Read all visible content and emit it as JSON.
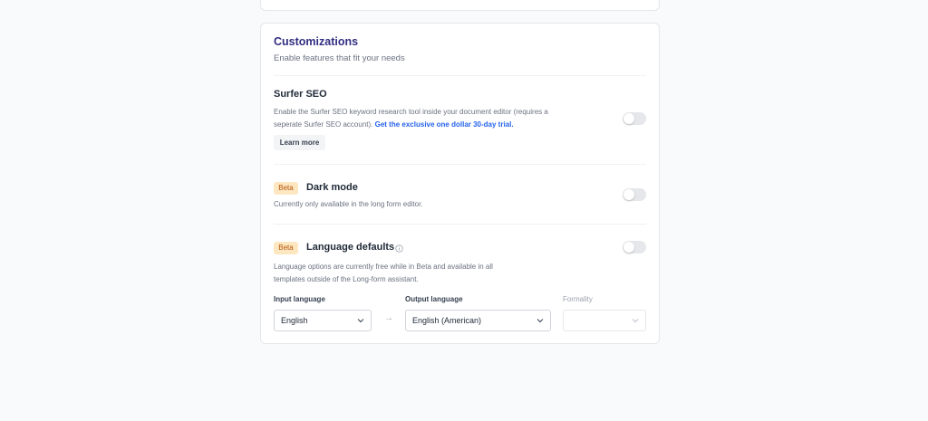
{
  "customizations": {
    "title": "Customizations",
    "subtitle": "Enable features that fit your needs"
  },
  "surfer": {
    "title": "Surfer SEO",
    "description_line1": "Enable the Surfer SEO keyword research tool inside your document editor (requires a",
    "description_line2": "seperate Surfer SEO account).",
    "trial_link": "Get the exclusive one dollar 30-day trial.",
    "learn_more": "Learn more",
    "enabled": false
  },
  "dark_mode": {
    "badge": "Beta",
    "title": "Dark mode",
    "description": "Currently only available in the long form editor.",
    "enabled": false
  },
  "language": {
    "badge": "Beta",
    "title": "Language defaults",
    "description_line1": "Language options are currently free while in Beta and available in all",
    "description_line2": "templates outside of the Long-form assistant.",
    "enabled": false,
    "input_label": "Input language",
    "input_value": "English",
    "output_label": "Output language",
    "output_value": "English (American)",
    "formality_label": "Formality",
    "formality_value": ""
  },
  "colors": {
    "accent": "#312e81",
    "link": "#2563eb",
    "badge_bg": "#fde7c1",
    "badge_text": "#b45309",
    "toggle_off": "#e5e7eb"
  },
  "icons": {
    "info": "info-circle-icon",
    "chevron": "chevron-down-icon",
    "arrow": "arrow-right-icon"
  }
}
